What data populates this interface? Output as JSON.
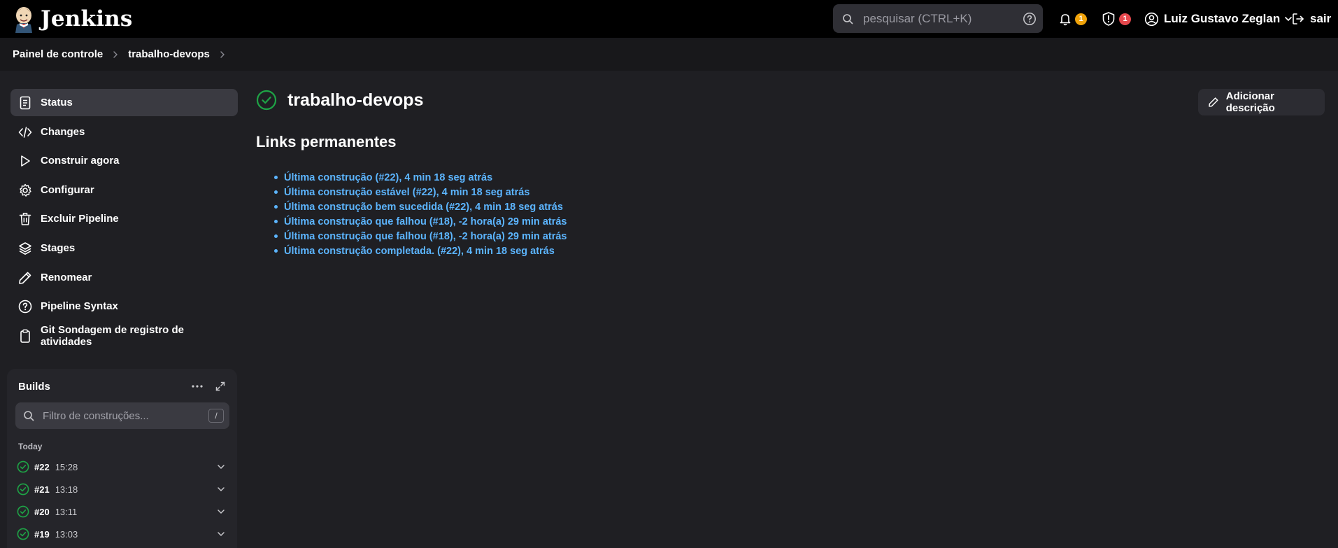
{
  "header": {
    "brand": "Jenkins",
    "search_placeholder": "pesquisar (CTRL+K)",
    "notifications_count": "1",
    "security_count": "1",
    "user_name": "Luiz Gustavo Zeglan",
    "logout_label": "sair"
  },
  "breadcrumb": [
    "Painel de controle",
    "trabalho-devops"
  ],
  "sidebar": {
    "tasks": [
      {
        "label": "Status",
        "icon": "status-icon",
        "active": true
      },
      {
        "label": "Changes",
        "icon": "code-icon"
      },
      {
        "label": "Construir agora",
        "icon": "play-icon"
      },
      {
        "label": "Configurar",
        "icon": "gear-icon"
      },
      {
        "label": "Excluir Pipeline",
        "icon": "trash-icon"
      },
      {
        "label": "Stages",
        "icon": "layers-icon"
      },
      {
        "label": "Renomear",
        "icon": "pencil-icon"
      },
      {
        "label": "Pipeline Syntax",
        "icon": "help-circle-icon"
      },
      {
        "label": "Git Sondagem de registro de atividades",
        "icon": "clipboard-icon"
      }
    ]
  },
  "builds": {
    "title": "Builds",
    "filter_placeholder": "Filtro de construções...",
    "filter_shortcut": "/",
    "group_label": "Today",
    "items": [
      {
        "number": "#22",
        "time": "15:28",
        "status": "success"
      },
      {
        "number": "#21",
        "time": "13:18",
        "status": "success"
      },
      {
        "number": "#20",
        "time": "13:11",
        "status": "success"
      },
      {
        "number": "#19",
        "time": "13:03",
        "status": "success"
      }
    ]
  },
  "main": {
    "job_name": "trabalho-devops",
    "add_description_label": "Adicionar descrição",
    "permalinks_title": "Links permanentes",
    "permalinks": [
      "Última construção (#22), 4 min 18 seg atrás",
      "Última construção estável (#22), 4 min 18 seg atrás",
      "Última construção bem sucedida (#22), 4 min 18 seg atrás",
      "Última construção que falhou (#18), -2 hora(a) 29 min atrás",
      "Última construção que falhou (#18), -2 hora(a) 29 min atrás",
      "Última construção completada. (#22), 4 min 18 seg atrás"
    ]
  },
  "colors": {
    "header_bg": "#000000",
    "page_bg": "#1f1f23",
    "success": "#1ea446",
    "link": "#5cb5ff",
    "badge_notifications": "#f0a30a",
    "badge_security": "#e5484d"
  }
}
